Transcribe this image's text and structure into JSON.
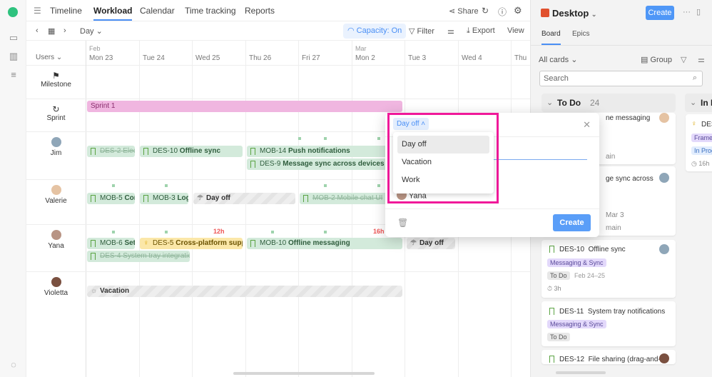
{
  "nav": {
    "tabs": [
      "Timeline",
      "Workload",
      "Calendar",
      "Time tracking",
      "Reports"
    ],
    "active": "Workload",
    "share": "Share"
  },
  "toolbar": {
    "scale": "Day",
    "capacity": "Capacity: On",
    "filter": "Filter",
    "export": "Export",
    "view": "View"
  },
  "grid": {
    "users_label": "Users",
    "months": {
      "feb": "Feb",
      "mar": "Mar"
    },
    "days": [
      "Mon 23",
      "Tue 24",
      "Wed 25",
      "Thu 26",
      "Fri 27",
      "Mon 2",
      "Tue 3",
      "Wed 4",
      "Thu"
    ],
    "rows": {
      "milestone": "Milestone",
      "sprint": "Sprint",
      "jim": "Jim",
      "valerie": "Valerie",
      "yana": "Yana",
      "violetta": "Violetta"
    },
    "sprint_bar": "Sprint 1",
    "tasks": {
      "jim1": {
        "key": "DES-2",
        "title": "Elect"
      },
      "jim2": {
        "key": "DES-10",
        "title": "Offline sync"
      },
      "jim3": {
        "key": "MOB-14",
        "title": "Push notifications"
      },
      "jim4": {
        "key": "DES-9",
        "title": "Message sync across devices"
      },
      "val1": {
        "key": "MOB-5",
        "title": "Com"
      },
      "val2": {
        "key": "MOB-3",
        "title": "Logi"
      },
      "val3": "Day off",
      "val4": {
        "key": "MOB-2",
        "title": "Mobile chat UI"
      },
      "yana1": {
        "key": "MOB-6",
        "title": "Sett"
      },
      "yana2": {
        "key": "DES-5",
        "title": "Cross-platform support"
      },
      "yana3": {
        "key": "MOB-10",
        "title": "Offline messaging"
      },
      "yana4": {
        "key": "DES-4",
        "title": "System tray integration"
      },
      "yana5": "Day off",
      "vio1": "Vacation"
    },
    "overload": {
      "wed25": "12h",
      "tue3": "16h"
    }
  },
  "modal": {
    "type_selected": "Day off",
    "options": [
      "Day off",
      "Vacation",
      "Work"
    ],
    "assignee": "Yana",
    "create": "Create"
  },
  "panel": {
    "project": "Desktop",
    "create": "Create",
    "tabs": [
      "Board",
      "Epics"
    ],
    "filter": "All cards",
    "group": "Group",
    "search_placeholder": "Search",
    "columns": [
      {
        "name": "To Do",
        "count": "24"
      },
      {
        "name": "In P"
      }
    ],
    "cards": [
      {
        "title": "ne messaging",
        "remain": "ain"
      },
      {
        "title": "ge sync across",
        "date": "Mar 3",
        "remain": "main"
      },
      {
        "key": "DES-10",
        "title": "Offline sync",
        "tag": "Messaging & Sync",
        "status": "To Do",
        "date": "Feb 24–25",
        "est": "3h"
      },
      {
        "key": "DES-11",
        "title": "System tray notifications",
        "tag": "Messaging & Sync",
        "status": "To Do"
      },
      {
        "key": "DES-12",
        "title": "File sharing (drag-and-"
      }
    ],
    "inprog": {
      "key": "DES",
      "tag": "Framew",
      "status": "In Prog",
      "est": "16h"
    }
  }
}
